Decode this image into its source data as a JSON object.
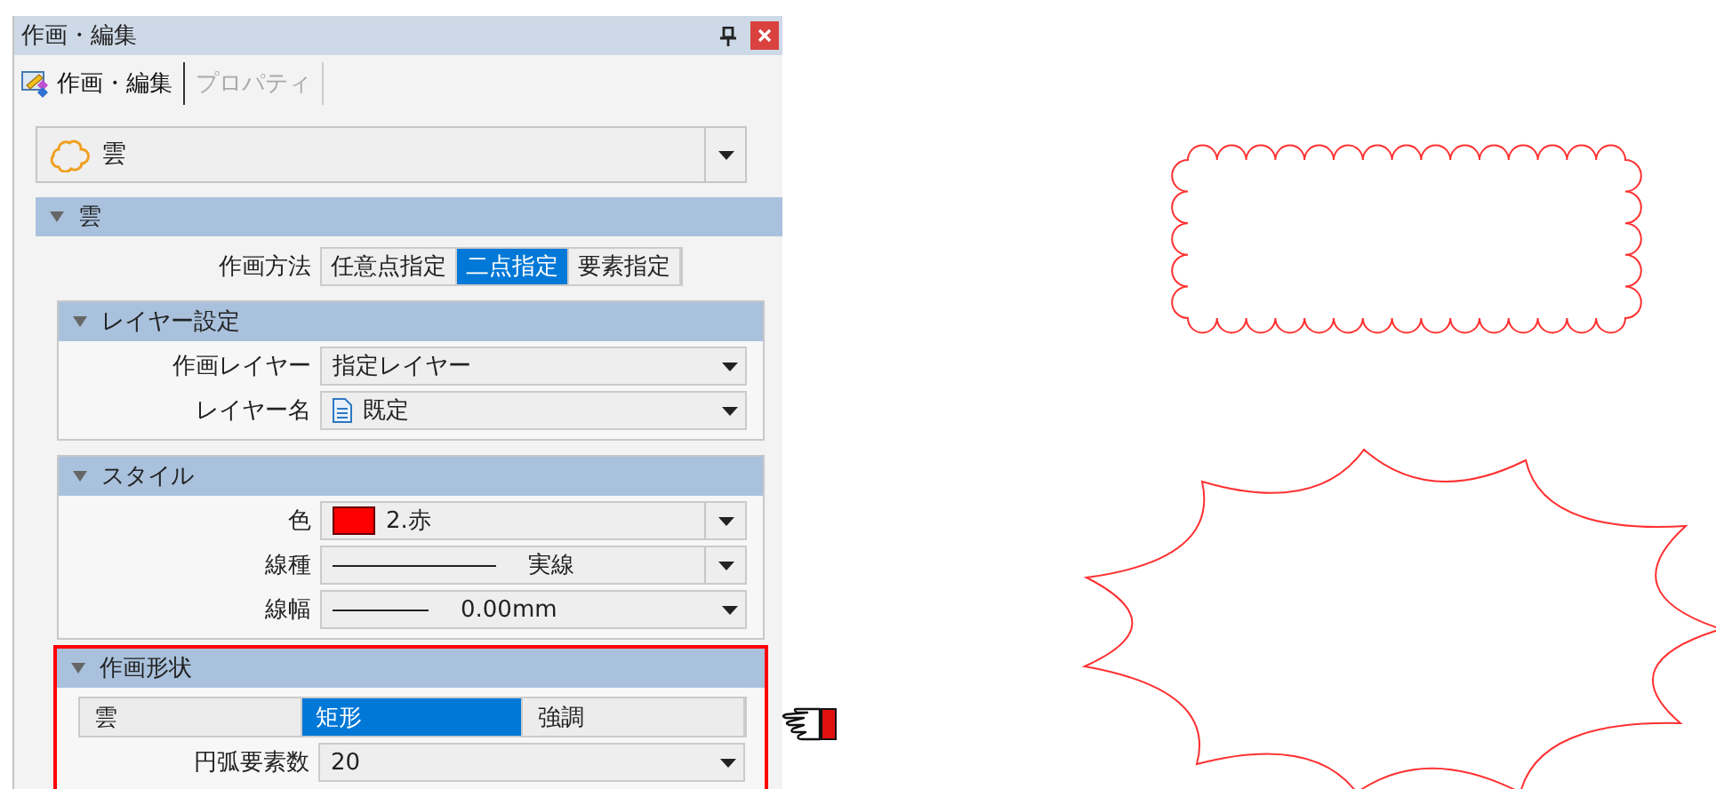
{
  "panel": {
    "title": "作画・編集"
  },
  "tabs": [
    {
      "label": "作画・編集",
      "selected": true
    },
    {
      "label": "プロパティ",
      "selected": false
    }
  ],
  "shape_select": {
    "value": "雲"
  },
  "section": {
    "title": "雲",
    "expanded": true,
    "rows": [
      {
        "kind": "segmented",
        "label": "作画方法",
        "options": [
          {
            "label": "任意点指定",
            "selected": false
          },
          {
            "label": "二点指定",
            "selected": true
          },
          {
            "label": "要素指定",
            "selected": false
          }
        ]
      }
    ],
    "groups": [
      {
        "title": "レイヤー設定",
        "expanded": true,
        "highlighted": false,
        "rows": [
          {
            "kind": "select",
            "label": "作画レイヤー",
            "value": "指定レイヤー",
            "split": false
          },
          {
            "kind": "document_select",
            "label": "レイヤー名",
            "value": "既定",
            "split": false
          }
        ]
      },
      {
        "title": "スタイル",
        "expanded": true,
        "highlighted": false,
        "rows": [
          {
            "kind": "color_select",
            "label": "色",
            "value": "2.赤",
            "color": "#ff0000",
            "split": true
          },
          {
            "kind": "linetype_select",
            "label": "線種",
            "value": "実線",
            "split": true
          },
          {
            "kind": "linewidth_select",
            "label": "線幅",
            "value": "0.00mm",
            "split": false
          }
        ]
      },
      {
        "title": "作画形状",
        "expanded": true,
        "highlighted": true,
        "rows": [
          {
            "kind": "tabs",
            "options": [
              {
                "label": "雲",
                "selected": false
              },
              {
                "label": "矩形",
                "selected": true
              },
              {
                "label": "強調",
                "selected": false
              }
            ]
          },
          {
            "kind": "select",
            "label": "円弧要素数",
            "value": "20",
            "split": false
          }
        ]
      }
    ]
  }
}
